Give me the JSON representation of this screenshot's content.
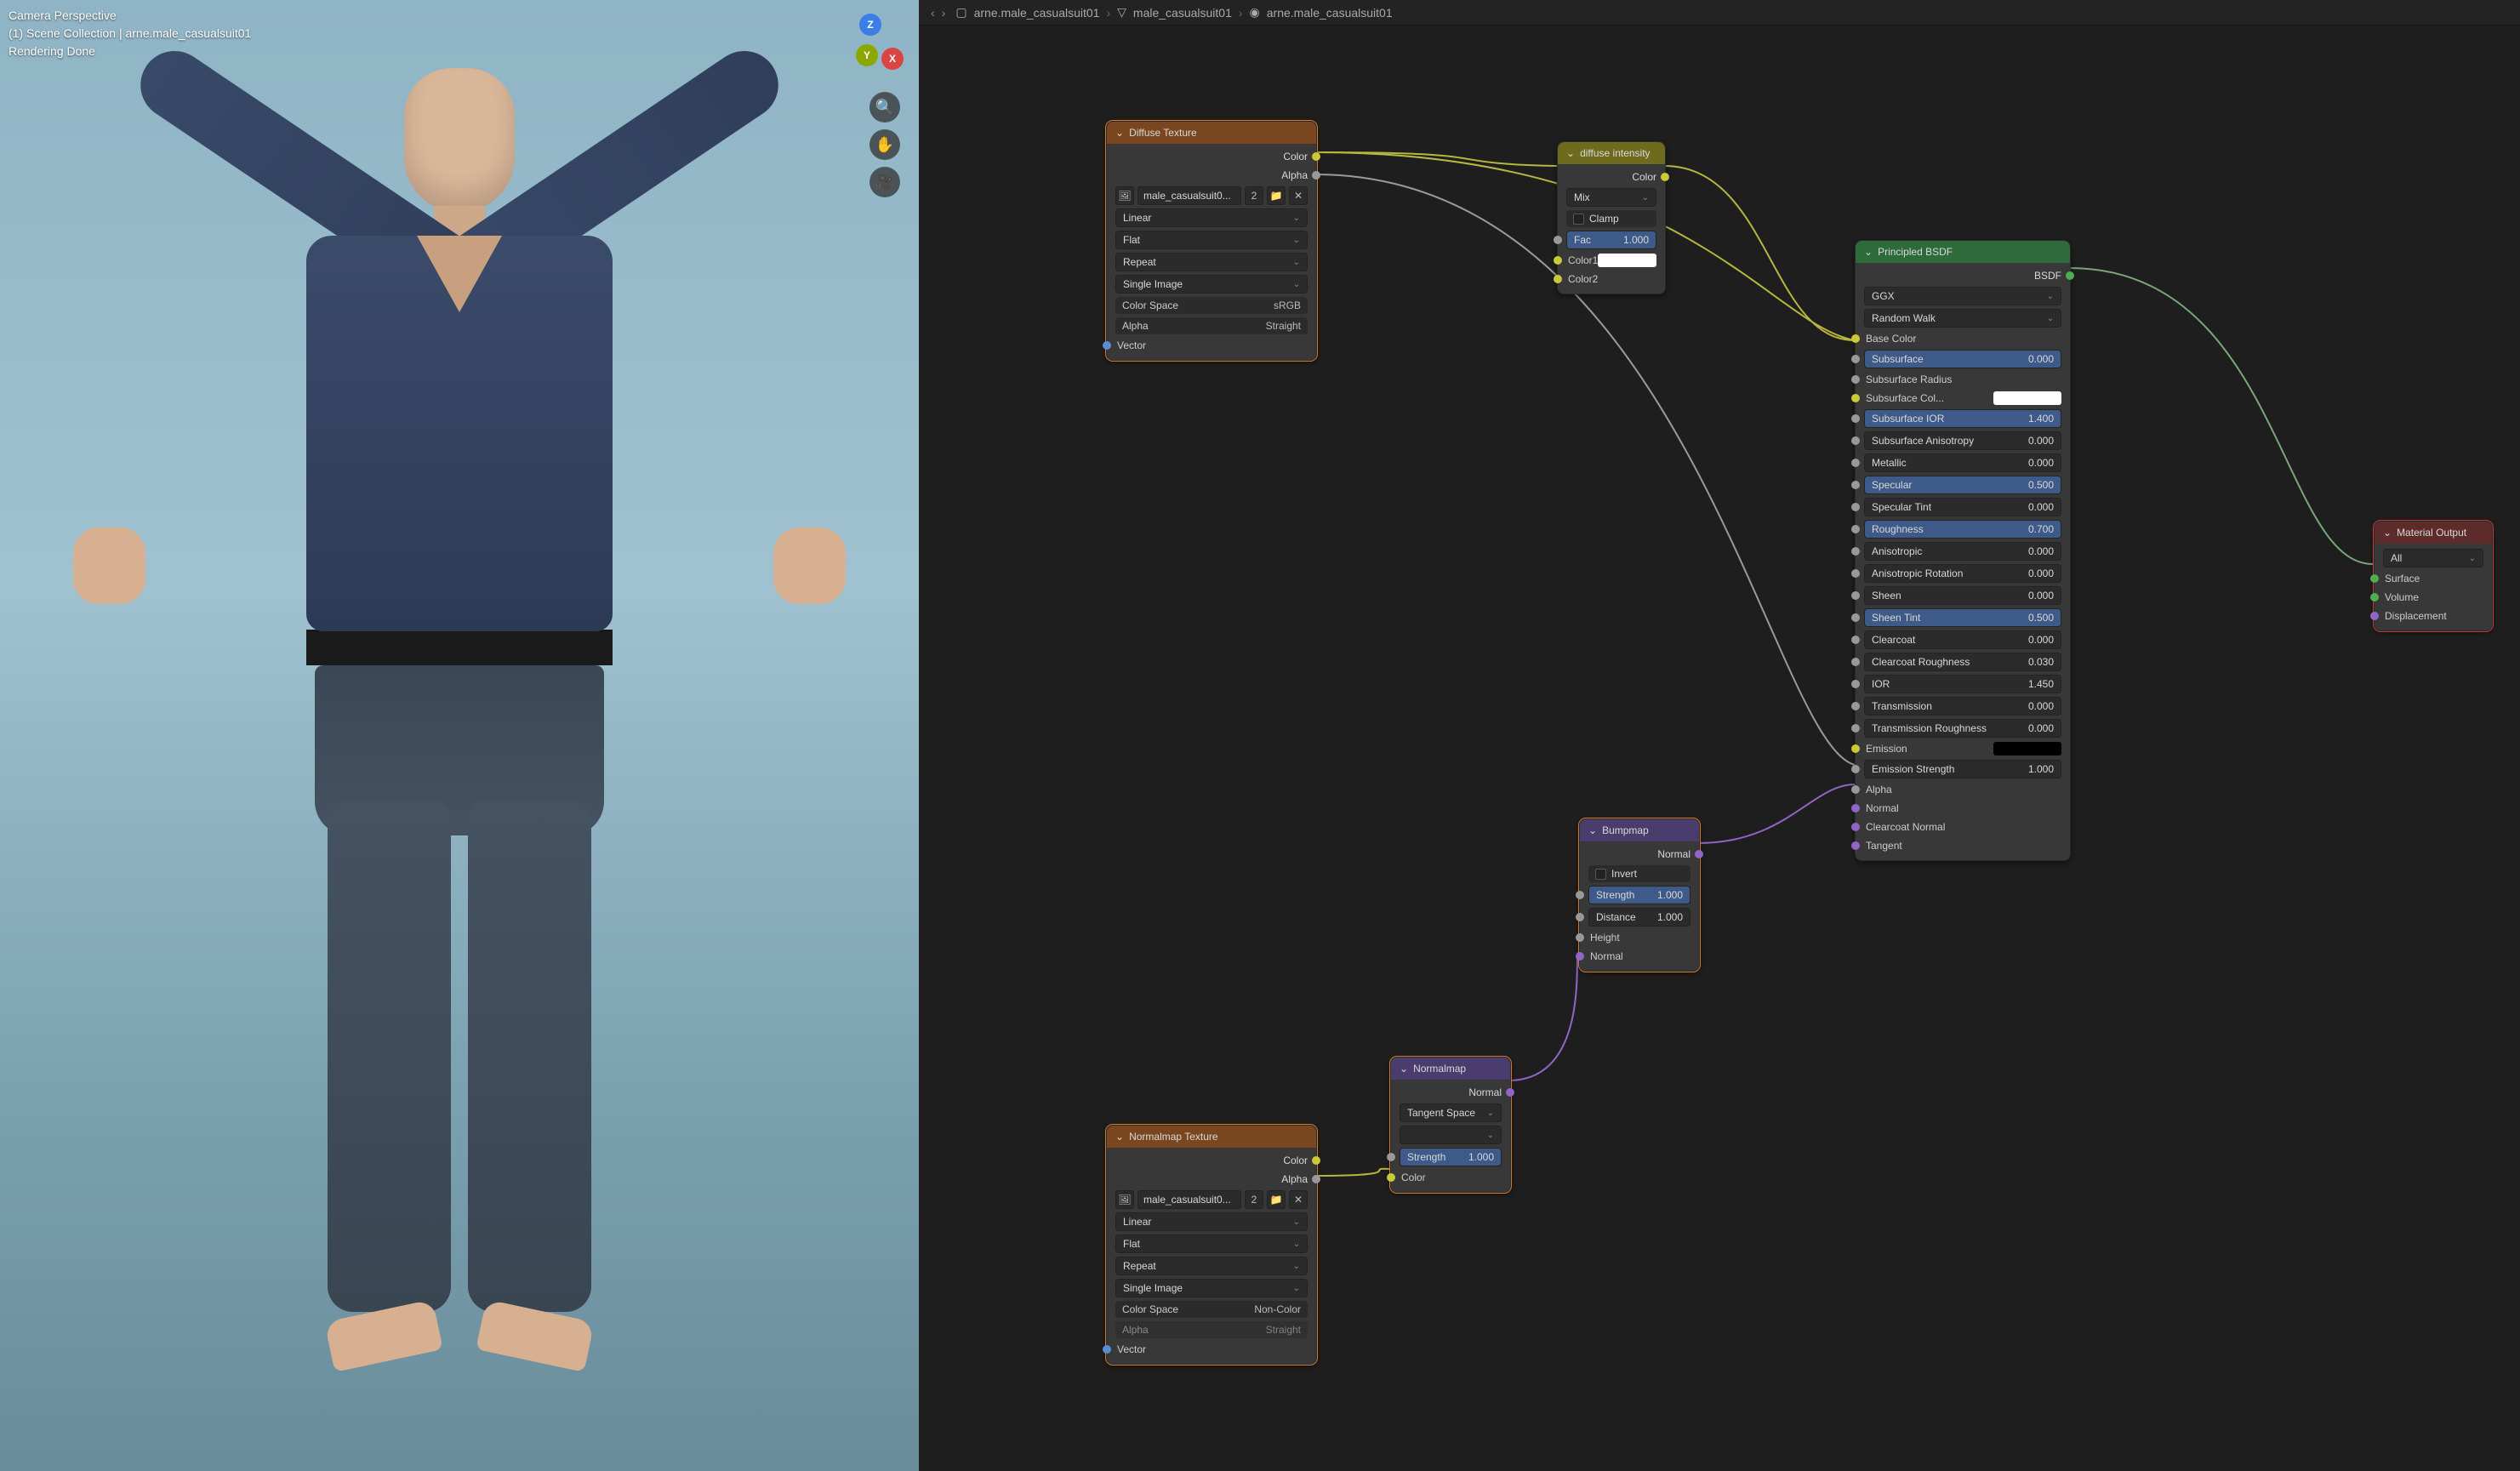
{
  "viewport": {
    "title": "Camera Perspective",
    "scene_line": "(1) Scene Collection | arne.male_casualsuit01",
    "status": "Rendering Done",
    "axes": {
      "x": "X",
      "y": "Y",
      "z": "Z"
    }
  },
  "header": {
    "crumb1": "arne.male_casualsuit01",
    "crumb2": "male_casualsuit01",
    "crumb3": "arne.male_casualsuit01"
  },
  "nodes": {
    "diffuse_tex": {
      "title": "Diffuse Texture",
      "out_color": "Color",
      "out_alpha": "Alpha",
      "image_name": "male_casualsuit0...",
      "interp": "Linear",
      "projection": "Flat",
      "extension": "Repeat",
      "source": "Single Image",
      "cs_label": "Color Space",
      "cs_value": "sRGB",
      "alpha_label": "Alpha",
      "alpha_value": "Straight",
      "in_vector": "Vector"
    },
    "diffuse_int": {
      "title": "diffuse intensity",
      "out_color": "Color",
      "mode": "Mix",
      "clamp": "Clamp",
      "fac_label": "Fac",
      "fac_value": "1.000",
      "color1": "Color1",
      "color2": "Color2"
    },
    "bsdf": {
      "title": "Principled BSDF",
      "out_bsdf": "BSDF",
      "dist": "GGX",
      "sss": "Random Walk",
      "base_color": "Base Color",
      "rows": [
        {
          "label": "Subsurface",
          "value": "0.000",
          "blue": true
        },
        {
          "label": "Subsurface Radius",
          "value": "",
          "blue": false
        },
        {
          "label": "Subsurface Col...",
          "value": "",
          "swatch": "white",
          "blue": false
        },
        {
          "label": "Subsurface IOR",
          "value": "1.400",
          "blue": true
        },
        {
          "label": "Subsurface Anisotropy",
          "value": "0.000",
          "blue": false
        },
        {
          "label": "Metallic",
          "value": "0.000",
          "blue": false
        },
        {
          "label": "Specular",
          "value": "0.500",
          "blue": true
        },
        {
          "label": "Specular Tint",
          "value": "0.000",
          "blue": false
        },
        {
          "label": "Roughness",
          "value": "0.700",
          "blue": true
        },
        {
          "label": "Anisotropic",
          "value": "0.000",
          "blue": false
        },
        {
          "label": "Anisotropic Rotation",
          "value": "0.000",
          "blue": false
        },
        {
          "label": "Sheen",
          "value": "0.000",
          "blue": false
        },
        {
          "label": "Sheen Tint",
          "value": "0.500",
          "blue": true
        },
        {
          "label": "Clearcoat",
          "value": "0.000",
          "blue": false
        },
        {
          "label": "Clearcoat Roughness",
          "value": "0.030",
          "blue": false
        },
        {
          "label": "IOR",
          "value": "1.450",
          "blue": false
        },
        {
          "label": "Transmission",
          "value": "0.000",
          "blue": false
        },
        {
          "label": "Transmission Roughness",
          "value": "0.000",
          "blue": false
        }
      ],
      "emission": "Emission",
      "emission_strength_label": "Emission Strength",
      "emission_strength_value": "1.000",
      "alpha": "Alpha",
      "normal": "Normal",
      "clearcoat_normal": "Clearcoat Normal",
      "tangent": "Tangent"
    },
    "mat_out": {
      "title": "Material Output",
      "target": "All",
      "surface": "Surface",
      "volume": "Volume",
      "displacement": "Displacement"
    },
    "bump": {
      "title": "Bumpmap",
      "out_normal": "Normal",
      "invert": "Invert",
      "strength_label": "Strength",
      "strength_value": "1.000",
      "distance_label": "Distance",
      "distance_value": "1.000",
      "height": "Height",
      "normal": "Normal"
    },
    "normalmap": {
      "title": "Normalmap",
      "out_normal": "Normal",
      "space": "Tangent Space",
      "strength_label": "Strength",
      "strength_value": "1.000",
      "color": "Color"
    },
    "normal_tex": {
      "title": "Normalmap Texture",
      "out_color": "Color",
      "out_alpha": "Alpha",
      "image_name": "male_casualsuit0...",
      "interp": "Linear",
      "projection": "Flat",
      "extension": "Repeat",
      "source": "Single Image",
      "cs_label": "Color Space",
      "cs_value": "Non-Color",
      "alpha_label": "Alpha",
      "alpha_value": "Straight",
      "in_vector": "Vector"
    }
  }
}
